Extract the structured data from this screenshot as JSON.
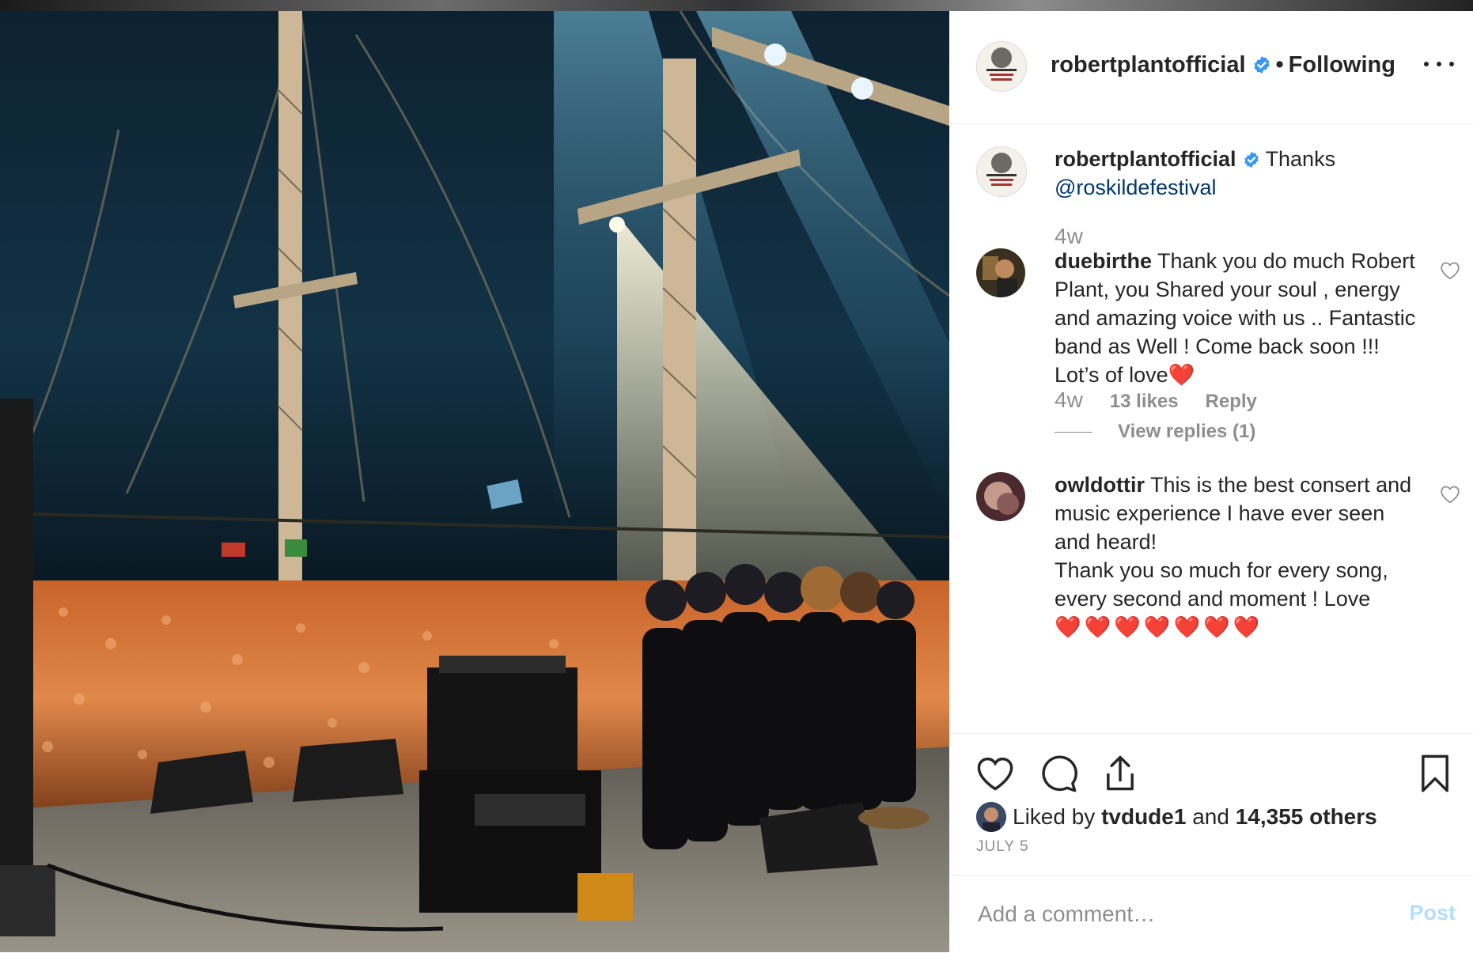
{
  "post": {
    "username": "robertplantofficial",
    "follow_status": "Following",
    "more_icon": "more-horizontal-icon",
    "image_icon": "concert-stage-photo"
  },
  "caption": {
    "username": "robertplantofficial",
    "text": "Thanks",
    "mention": "@roskildefestival",
    "age": "4w"
  },
  "comments": [
    {
      "username": "duebirthe",
      "text": "Thank you do much Robert Plant, you Shared your soul , energy and amazing voice with us .. Fantastic band as Well ! Come back soon !!! Lot’s of love❤️",
      "age": "4w",
      "likes": "13 likes",
      "reply_label": "Reply",
      "view_replies": "View replies (1)"
    },
    {
      "username": "owldottir",
      "text": "This is the best consert and music experience I have ever seen and heard!",
      "text2": "Thank you so much for every song, every second and moment ! Love",
      "hearts": "❤️❤️❤️❤️❤️❤️❤️"
    }
  ],
  "likes": {
    "prefix": "Liked by",
    "user": "tvdude1",
    "conj": "and",
    "others": "14,355 others"
  },
  "date": "JULY 5",
  "add_comment": {
    "placeholder": "Add a comment…",
    "post_label": "Post"
  },
  "colors": {
    "text": "#262626",
    "secondary": "#8e8e8e",
    "link": "#00376b",
    "verified": "#3897f0",
    "post_disabled": "#b2dffc"
  }
}
